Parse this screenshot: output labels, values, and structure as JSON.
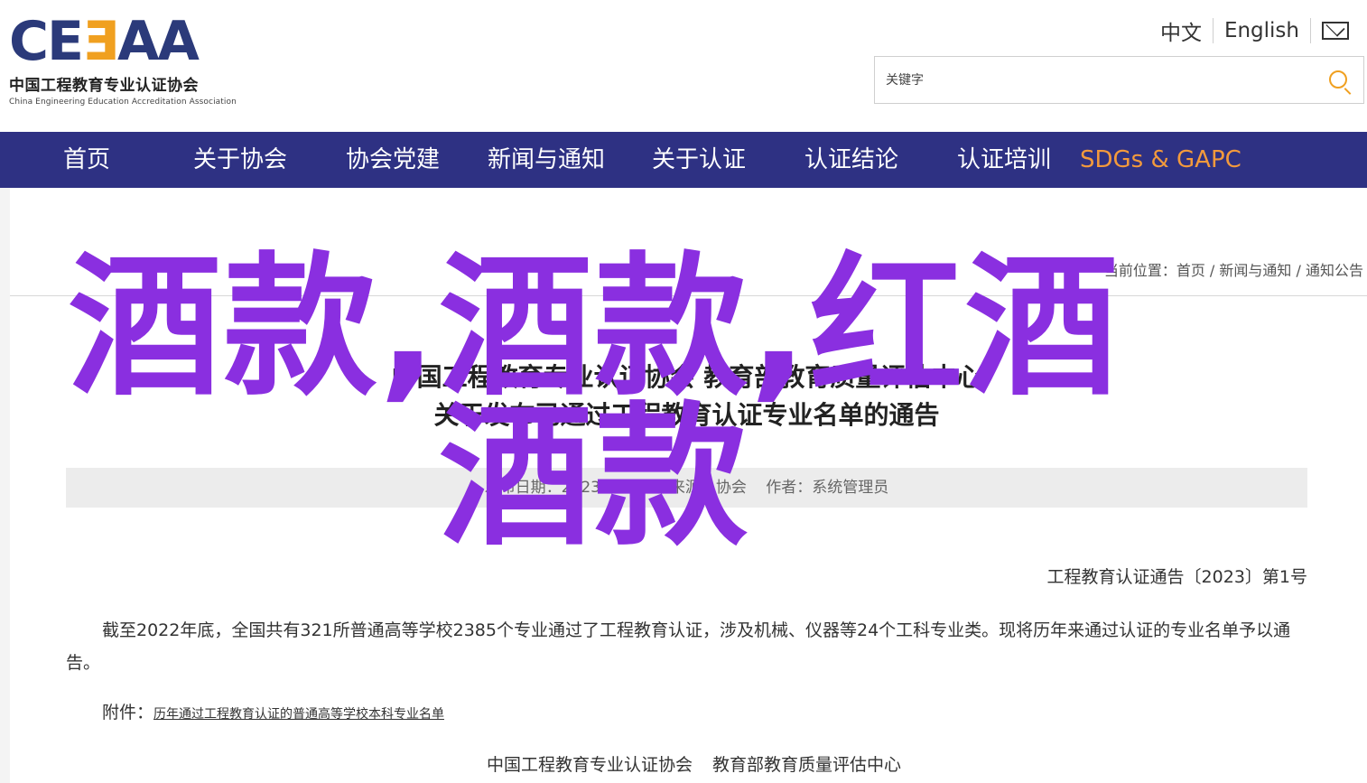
{
  "logo": {
    "mark_primary": "CE",
    "mark_accent": "Ǝ",
    "mark_tail": "AA",
    "name_cn": "中国工程教育专业认证协会",
    "name_en": "China Engineering Education Accreditation Association"
  },
  "lang": {
    "zh": "中文",
    "en": "English"
  },
  "search": {
    "placeholder": "关键字"
  },
  "nav": {
    "items": [
      "首页",
      "关于协会",
      "协会党建",
      "新闻与通知",
      "关于认证",
      "认证结论",
      "认证培训",
      "SDGs & GAPC"
    ],
    "highlight_color": "#f39a3c",
    "bg_color": "#2e3183"
  },
  "breadcrumb": {
    "prefix": "当前位置：",
    "items": [
      "首页",
      "新闻与通知",
      "通知公告"
    ],
    "separator": " / "
  },
  "article": {
    "title_line1": "中国工程教育专业认证协会 教育部教育质量评估中心",
    "title_line2": "关于发布已通过工程教育认证专业名单的通告",
    "meta": {
      "date": "发布日期：2023-06-28",
      "source": "来源：协会",
      "author": "作者：系统管理员"
    },
    "doc_number": "工程教育认证通告〔2023〕第1号",
    "paragraph": "截至2022年底，全国共有321所普通高等学校2385个专业通过了工程教育认证，涉及机械、仪器等24个工科专业类。现将历年来通过认证的专业名单予以通告。",
    "attachment_label": "附件：",
    "attachment_link": "历年通过工程教育认证的普通高等学校本科专业名单",
    "signatories": [
      "中国工程教育专业认证协会",
      "教育部教育质量评估中心"
    ]
  },
  "overlay": {
    "text": "酒款,酒款,红酒酒款",
    "color": "#8a2fe0"
  }
}
